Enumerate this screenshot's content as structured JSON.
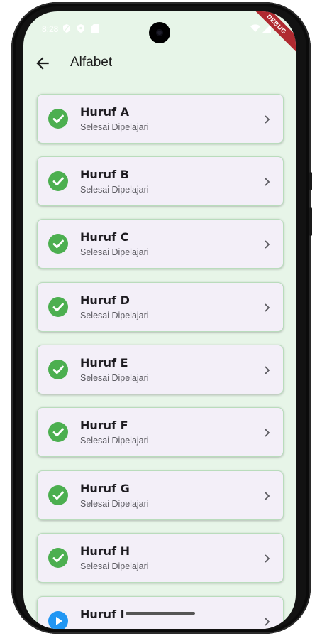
{
  "statusbar": {
    "time": "8:28"
  },
  "debug_banner": "DEBUG",
  "appbar": {
    "title": "Alfabet"
  },
  "items": [
    {
      "title": "Huruf A",
      "subtitle": "Selesai Dipelajari",
      "status": "done"
    },
    {
      "title": "Huruf B",
      "subtitle": "Selesai Dipelajari",
      "status": "done"
    },
    {
      "title": "Huruf C",
      "subtitle": "Selesai Dipelajari",
      "status": "done"
    },
    {
      "title": "Huruf D",
      "subtitle": "Selesai Dipelajari",
      "status": "done"
    },
    {
      "title": "Huruf E",
      "subtitle": "Selesai Dipelajari",
      "status": "done"
    },
    {
      "title": "Huruf F",
      "subtitle": "Selesai Dipelajari",
      "status": "done"
    },
    {
      "title": "Huruf G",
      "subtitle": "Selesai Dipelajari",
      "status": "done"
    },
    {
      "title": "Huruf H",
      "subtitle": "Selesai Dipelajari",
      "status": "done"
    },
    {
      "title": "Huruf I",
      "subtitle": "",
      "status": "in-progress"
    }
  ],
  "colors": {
    "background": "#e7f5e8",
    "card": "#f3eff8",
    "done": "#4caf50",
    "in_progress": "#2196f3"
  },
  "icons": {
    "back": "arrow-back-icon",
    "done": "check-circle-icon",
    "in_progress": "play-circle-icon",
    "chevron": "chevron-right-icon"
  }
}
